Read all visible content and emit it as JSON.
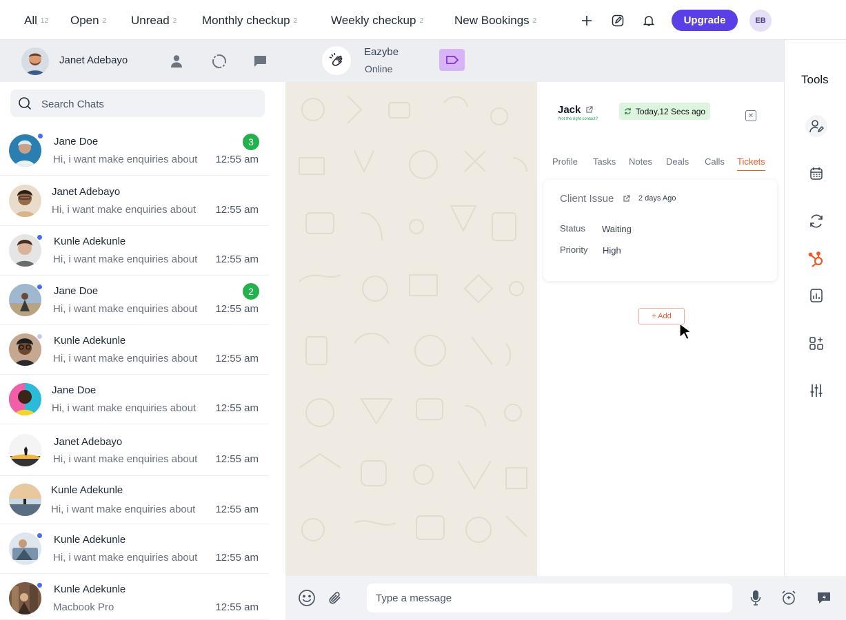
{
  "filters": {
    "tabs": [
      {
        "label": "All",
        "count": "12"
      },
      {
        "label": "Open",
        "count": "2"
      },
      {
        "label": "Unread",
        "count": "2"
      },
      {
        "label": "Monthly checkup",
        "count": "2"
      },
      {
        "label": "Weekly checkup",
        "count": "2"
      },
      {
        "label": "New Bookings",
        "count": "2"
      }
    ],
    "upgrade_label": "Upgrade",
    "user_initials": "EB"
  },
  "header": {
    "me_name": "Janet Adebayo",
    "chat_name": "Eazybe",
    "chat_status": "Online"
  },
  "chat_list": {
    "search_placeholder": "Search Chats",
    "chats": [
      {
        "name": "Jane Doe",
        "preview": "Hi, i want make enquiries about",
        "time": "12:55 am",
        "unread": "3",
        "online": true
      },
      {
        "name": "Janet Adebayo",
        "preview": "Hi, i want make enquiries about",
        "time": "12:55 am",
        "unread": "",
        "online": false
      },
      {
        "name": "Kunle Adekunle",
        "preview": "Hi, i want make enquiries about",
        "time": "12:55 am",
        "unread": "",
        "online": true
      },
      {
        "name": "Jane Doe",
        "preview": "Hi, i want make enquiries about",
        "time": "12:55 am",
        "unread": "2",
        "online": true
      },
      {
        "name": "Kunle Adekunle",
        "preview": "Hi, i want make enquiries about",
        "time": "12:55 am",
        "unread": "",
        "online": false
      },
      {
        "name": "Jane Doe",
        "preview": "Hi, i want make enquiries about",
        "time": "12:55 am",
        "unread": "",
        "online": false
      },
      {
        "name": "Janet Adebayo",
        "preview": "Hi, i want make enquiries about",
        "time": "12:55 am",
        "unread": "",
        "online": false
      },
      {
        "name": "Kunle Adekunle",
        "preview": "Hi, i want make enquiries about",
        "time": "12:55 am",
        "unread": "",
        "online": false
      },
      {
        "name": "Kunle Adekunle",
        "preview": "Hi, i want make enquiries about",
        "time": "12:55 am",
        "unread": "",
        "online": true
      },
      {
        "name": "Kunle Adekunle",
        "preview": "Macbook Pro",
        "time": "12:55 am",
        "unread": "",
        "online": true
      }
    ]
  },
  "contact_panel": {
    "name": "Jack",
    "not_right_contact": "Not the right contact?",
    "sync_status": "Today,12 Secs ago",
    "tabs": [
      "Profile",
      "Tasks",
      "Notes",
      "Deals",
      "Calls",
      "Tickets"
    ],
    "active_tab": "Tickets",
    "ticket": {
      "title": "Client Issue",
      "age": "2 days Ago",
      "status_label": "Status",
      "status_value": "Waiting",
      "priority_label": "Priority",
      "priority_value": "High"
    },
    "add_label": "Add"
  },
  "composer": {
    "placeholder": "Type a message"
  },
  "tools": {
    "title": "Tools",
    "items": [
      "contact-edit-icon",
      "calendar-icon",
      "sync-icon",
      "hubspot-icon",
      "analytics-icon",
      "apps-icon",
      "sliders-icon"
    ]
  },
  "colors": {
    "accent": "#5a3ee6",
    "active_tab": "#f05a28",
    "unread_badge": "#22b14c",
    "online_dot": "#4a6cf7",
    "offline_dot": "#c7cbe8"
  }
}
